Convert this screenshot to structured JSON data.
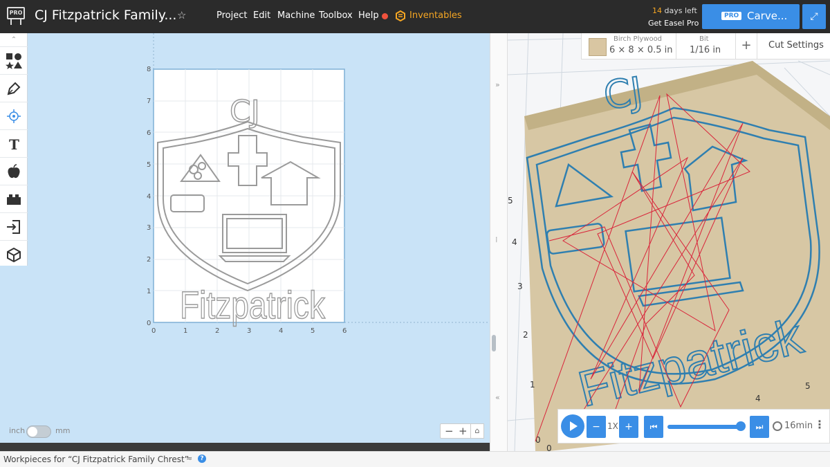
{
  "header": {
    "logo_text": "PRO",
    "project_title": "CJ Fitzpatrick Family...",
    "menu": [
      "Project",
      "Edit",
      "Machine",
      "Toolbox",
      "Help"
    ],
    "inventables": "Inventables",
    "days_num": "14",
    "days_text": " days left",
    "get_pro": "Get Easel Pro",
    "carve_pro_badge": "PRO",
    "carve_label": "Carve..."
  },
  "tools": [
    "shapes-icon",
    "pen-icon",
    "target-icon",
    "text-icon",
    "apple-icon",
    "lego-icon",
    "import-icon",
    "box-icon"
  ],
  "design": {
    "y_ticks": [
      "8",
      "7",
      "6",
      "5",
      "4",
      "3",
      "2",
      "1",
      "0"
    ],
    "x_ticks": [
      "0",
      "1",
      "2",
      "3",
      "4",
      "5",
      "6"
    ],
    "initials": "CJ",
    "surname": "Fitzpatrick"
  },
  "units": {
    "inch": "inch",
    "mm": "mm"
  },
  "zoom": {
    "minus": "−",
    "plus": "+"
  },
  "material": {
    "name": "Birch Plywood",
    "size": "6 × 8 × 0.5 in",
    "bit_label": "Bit",
    "bit_size": "1/16 in",
    "add": "+",
    "cut_settings": "Cut Settings"
  },
  "preview": {
    "y_ticks": [
      "5",
      "4",
      "3",
      "2",
      "1",
      "0"
    ],
    "x_ticks": [
      "0",
      "4",
      "5"
    ],
    "initials": "CJ",
    "surname": "Fitzpatrick"
  },
  "playback": {
    "minus": "−",
    "speed": "1X",
    "plus": "+",
    "rewind": "⏮",
    "forward": "⏭",
    "duration": "16min",
    "more": "⋮"
  },
  "status": {
    "workpieces": "Workpieces for “CJ Fitzpatrick Family Chrest”",
    "arrow": "≈",
    "help": "?"
  }
}
